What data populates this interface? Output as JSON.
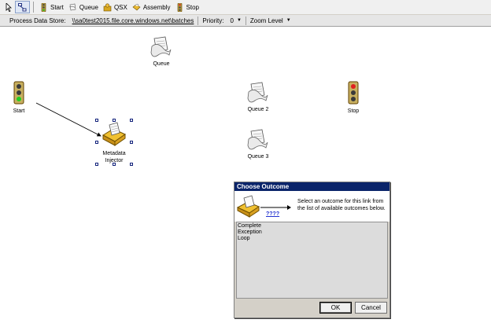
{
  "toolbar": {
    "items": [
      {
        "label": "Start",
        "icon": "traffic-light-icon"
      },
      {
        "label": "Queue",
        "icon": "queue-icon"
      },
      {
        "label": "QSX",
        "icon": "qsx-icon"
      },
      {
        "label": "Assembly",
        "icon": "assembly-icon"
      },
      {
        "label": "Stop",
        "icon": "stop-icon"
      }
    ]
  },
  "pathbar": {
    "store_label": "Process Data Store:",
    "store_path": "\\\\sa0test2015.file.core.windows.net\\batches",
    "priority_label": "Priority:",
    "priority_value": "0",
    "zoom_label": "Zoom Level"
  },
  "nodes": {
    "queue": "Queue",
    "start": "Start",
    "queue2": "Queue 2",
    "stop": "Stop",
    "metadata": "Metadata\nInjector",
    "queue3": "Queue 3"
  },
  "dialog": {
    "title": "Choose Outcome",
    "placeholder": "????",
    "prompt": "Select an outcome for this link from the list of available outcomes below.",
    "outcomes": [
      "Complete",
      "Exception",
      "Loop"
    ],
    "ok_label": "OK",
    "cancel_label": "Cancel"
  },
  "colors": {
    "title_bar": "#0a246a",
    "selection_handle": "#10207a"
  }
}
